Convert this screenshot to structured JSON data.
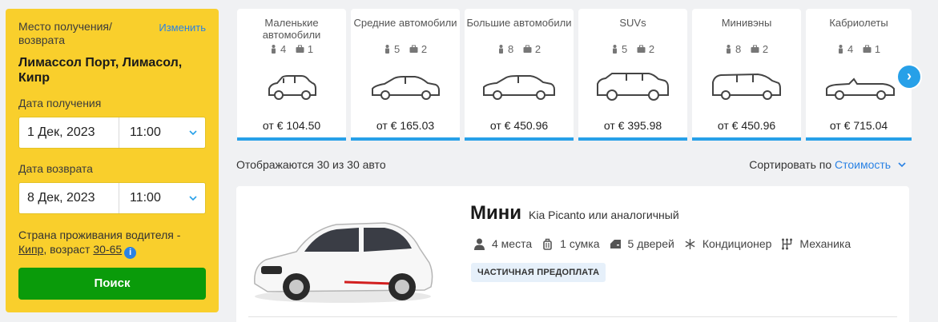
{
  "search": {
    "location_label": "Место получения/\nвозврата",
    "change_link": "Изменить",
    "location_value": "Лимассол Порт, Лимасол, Кипр",
    "pickup_label": "Дата получения",
    "pickup_date": "1 Дек, 2023",
    "pickup_time": "11:00",
    "return_label": "Дата возврата",
    "return_date": "8 Дек, 2023",
    "return_time": "11:00",
    "residence_prefix": "Страна проживания водителя - ",
    "residence_country": "Кипр",
    "residence_mid": ", возраст ",
    "residence_age": "30-65",
    "search_button": "Поиск"
  },
  "categories": [
    {
      "name": "Маленькие автомобили",
      "seats": "4",
      "bags": "1",
      "price": "от € 104.50",
      "icon": "small-car-icon"
    },
    {
      "name": "Средние автомобили",
      "seats": "5",
      "bags": "2",
      "price": "от € 165.03",
      "icon": "sedan-icon"
    },
    {
      "name": "Большие автомобили",
      "seats": "8",
      "bags": "2",
      "price": "от € 450.96",
      "icon": "large-sedan-icon"
    },
    {
      "name": "SUVs",
      "seats": "5",
      "bags": "2",
      "price": "от € 395.98",
      "icon": "suv-icon"
    },
    {
      "name": "Минивэны",
      "seats": "8",
      "bags": "2",
      "price": "от € 450.96",
      "icon": "minivan-icon"
    },
    {
      "name": "Кабриолеты",
      "seats": "4",
      "bags": "1",
      "price": "от € 715.04",
      "icon": "convertible-icon"
    }
  ],
  "results_bar": {
    "count_text": "Отображаются 30 из 30 авто",
    "sort_label": "Сортировать по ",
    "sort_value": "Стоимость"
  },
  "result": {
    "title": "Мини",
    "subtitle": "Kia Picanto или аналогичный",
    "seats": "4 места",
    "bags": "1 сумка",
    "doors": "5 дверей",
    "ac": "Кондиционер",
    "transmission": "Механика",
    "badge": "ЧАСТИЧНАЯ ПРЕДОПЛАТА"
  },
  "colors": {
    "accent": "#27a0e8",
    "panel": "#f9cf2c",
    "search_button": "#0a9b0a",
    "link": "#2a82e4"
  }
}
